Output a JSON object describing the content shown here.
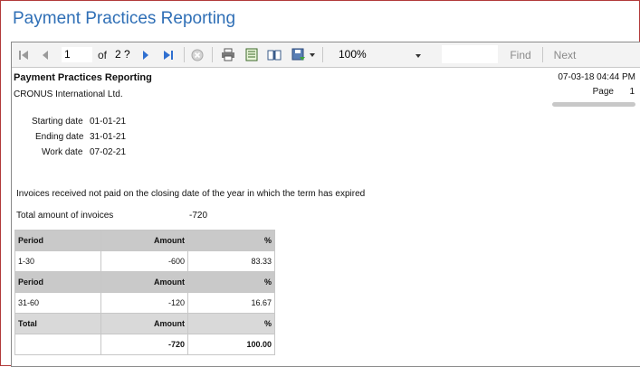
{
  "window": {
    "title": "Payment Practices Reporting"
  },
  "toolbar": {
    "current_page": "1",
    "of_label": "of",
    "total_pages": "2 ?",
    "zoom": "100%",
    "find_label": "Find",
    "next_label": "Next"
  },
  "report": {
    "title": "Payment Practices Reporting",
    "company": "CRONUS International Ltd.",
    "datetime": "07-03-18 04:44 PM",
    "page_label": "Page",
    "page_number": "1",
    "starting_date_label": "Starting date",
    "starting_date": "01-01-21",
    "ending_date_label": "Ending date",
    "ending_date": "31-01-21",
    "work_date_label": "Work date",
    "work_date": "07-02-21",
    "section_heading": "Invoices received not paid on the closing date of the year in which the term has expired",
    "total_invoices_label": "Total amount of invoices",
    "total_invoices_value": "-720"
  },
  "table": {
    "period_label": "Period",
    "amount_label": "Amount",
    "pct_label": "%",
    "total_label": "Total",
    "rows": [
      {
        "period": "1-30",
        "amount": "-600",
        "pct": "83.33"
      },
      {
        "period": "31-60",
        "amount": "-120",
        "pct": "16.67"
      }
    ],
    "total": {
      "amount": "-720",
      "pct": "100.00"
    }
  }
}
